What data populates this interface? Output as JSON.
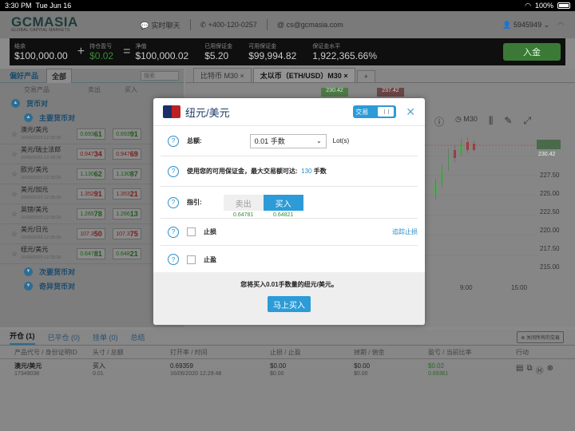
{
  "status": {
    "time": "3:30 PM",
    "date": "Tue Jun 16",
    "battery": "100%"
  },
  "header": {
    "logo": "GCMASIA",
    "logo_sub": "GLOBAL CAPITAL MARKETS",
    "chat": "实时聊天",
    "phone": "+400-120-0257",
    "email": "cs@gcmasia.com",
    "account_id": "5945949"
  },
  "account": {
    "balance_label": "结余",
    "balance": "$100,000.00",
    "pnl_label": "持仓盈亏",
    "pnl": "$0.02",
    "equity_label": "净值",
    "equity": "$100,000.02",
    "used_margin_label": "已用保证金",
    "used_margin": "$5.20",
    "free_margin_label": "可用保证金",
    "free_margin": "$99,994.82",
    "margin_level_label": "保证金水平",
    "margin_level": "1,922,365.66%",
    "deposit": "入金"
  },
  "left": {
    "tab_fav": "偏好产品",
    "tab_all": "全部",
    "search_placeholder": "搜索",
    "col_product": "交易产品",
    "col_sell": "卖出",
    "col_buy": "买入",
    "group_fx": "货币对",
    "group_major": "主要货币对",
    "group_minor": "次要货币对",
    "group_exotic": "奇异货币对",
    "rows": [
      {
        "name": "澳元/美元",
        "time": "16/06/2020 12:30:29",
        "sell_a": "0.693",
        "sell_b": "61",
        "buy_a": "0.693",
        "buy_b": "91"
      },
      {
        "name": "美元/瑞士法郎",
        "time": "16/06/2020 12:30:29",
        "sell_a": "0.947",
        "sell_b": "34",
        "buy_a": "0.947",
        "buy_b": "69"
      },
      {
        "name": "欧元/美元",
        "time": "16/06/2020 12:30:29",
        "sell_a": "1.130",
        "sell_b": "62",
        "buy_a": "1.130",
        "buy_b": "87"
      },
      {
        "name": "美元/加元",
        "time": "16/06/2020 12:30:29",
        "sell_a": "1.352",
        "sell_b": "91",
        "buy_a": "1.353",
        "buy_b": "21"
      },
      {
        "name": "英镑/美元",
        "time": "16/06/2020 12:30:29",
        "sell_a": "1.265",
        "sell_b": "78",
        "buy_a": "1.266",
        "buy_b": "13"
      },
      {
        "name": "美元/日元",
        "time": "16/06/2020 12:30:29",
        "sell_a": "107.3",
        "sell_b": "50",
        "buy_a": "107.3",
        "buy_b": "75"
      },
      {
        "name": "纽元/美元",
        "time": "16/06/2020 12:30:29",
        "sell_a": "0.647",
        "sell_b": "81",
        "buy_a": "0.648",
        "buy_b": "21"
      }
    ]
  },
  "chart": {
    "tab1": "比特币 M30",
    "tab2": "太以币（ETH/USD）M30",
    "bid": "230.42",
    "ask": "237.42",
    "last": "230.42",
    "timeframe": "M30",
    "y_ticks": [
      "227.50",
      "225.00",
      "222.50",
      "220.00",
      "217.50",
      "215.00"
    ],
    "x_ticks": [
      "9:00",
      "15:00"
    ]
  },
  "bottom": {
    "tabs": [
      "开仓 (1)",
      "已平仓 (0)",
      "挂单 (0)",
      "总结"
    ],
    "close_all": "关闭所有的交易",
    "cols": [
      "产品代号 / 身份证明ID",
      "头寸 / 总额",
      "打开率 / 时间",
      "止损 / 止盈",
      "掉期 / 佣金",
      "盈亏 / 当前比率",
      "行动"
    ],
    "row": {
      "product": "澳元/美元",
      "id": "17349038",
      "side": "买入",
      "amount": "0.01",
      "open": "0.69359",
      "time": "16/06/2020 12:29:48",
      "sl": "$0.00",
      "tp": "$0.00",
      "swap": "$0.00",
      "comm": "$0.00",
      "pnl": "$0.02",
      "rate": "0.69361"
    }
  },
  "modal": {
    "title": "纽元/美元",
    "trade_toggle": "交易",
    "amount_label": "总额:",
    "amount_value": "0.01 手数",
    "amount_unit": "Lot(s)",
    "margin_text": "使用您的可用保证金，最大交易额可达:",
    "max_value": "130",
    "max_unit": "手数",
    "direction_label": "指引:",
    "sell": "卖出",
    "buy": "买入",
    "sell_price": "0.64781",
    "buy_price": "0.64821",
    "stop_loss": "止损",
    "trailing": "追踪止损",
    "take_profit": "止盈",
    "summary": "您将买入0.01手数量的纽元/美元。",
    "submit": "马上买入"
  }
}
